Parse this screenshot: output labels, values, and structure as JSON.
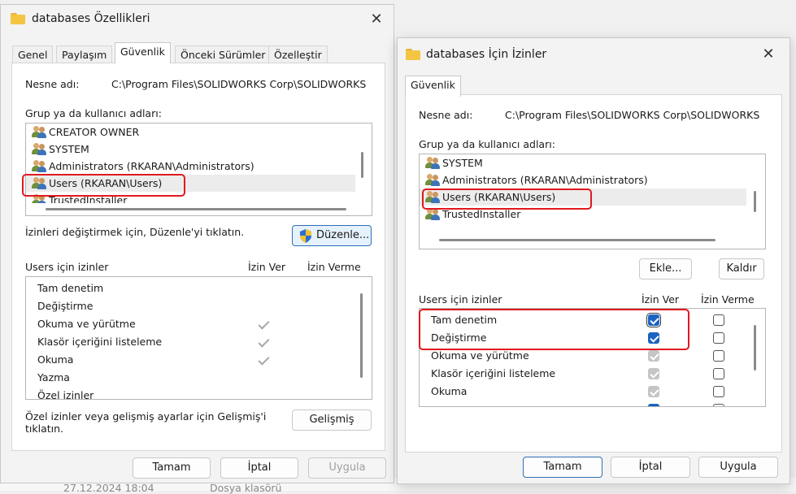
{
  "win1": {
    "title": "databases Özellikleri",
    "tabs": [
      "Genel",
      "Paylaşım",
      "Güvenlik",
      "Önceki Sürümler",
      "Özelleştir"
    ],
    "object_label": "Nesne adı:",
    "object_value": "C:\\Program Files\\SOLIDWORKS Corp\\SOLIDWORKS",
    "group_label": "Grup ya da kullanıcı adları:",
    "users": [
      "CREATOR OWNER",
      "SYSTEM",
      "Administrators (RKARAN\\Administrators)",
      "Users (RKARAN\\Users)",
      "TrustedInstaller"
    ],
    "edit_hint": "İzinleri değiştirmek için, Düzenle'yi tıklatın.",
    "edit_button": "Düzenle...",
    "perm_header": "Users için izinler",
    "allow_header": "İzin Ver",
    "deny_header": "İzin Verme",
    "permissions": [
      "Tam denetim",
      "Değiştirme",
      "Okuma ve yürütme",
      "Klasör içeriğini listeleme",
      "Okuma",
      "Yazma",
      "Özel izinler"
    ],
    "advanced_hint": "Özel izinler veya gelişmiş ayarlar için Gelişmiş'i tıklatın.",
    "advanced_button": "Gelişmiş",
    "ok": "Tamam",
    "cancel": "İptal",
    "apply": "Uygula"
  },
  "win2": {
    "title": "databases İçin İzinler",
    "tab": "Güvenlik",
    "object_label": "Nesne adı:",
    "object_value": "C:\\Program Files\\SOLIDWORKS Corp\\SOLIDWORKS",
    "group_label": "Grup ya da kullanıcı adları:",
    "users": [
      "SYSTEM",
      "Administrators (RKARAN\\Administrators)",
      "Users (RKARAN\\Users)",
      "TrustedInstaller"
    ],
    "add_button": "Ekle...",
    "remove_button": "Kaldır",
    "perm_header": "Users için izinler",
    "allow_header": "İzin Ver",
    "deny_header": "İzin Verme",
    "permissions": [
      "Tam denetim",
      "Değiştirme",
      "Okuma ve yürütme",
      "Klasör içeriğini listeleme",
      "Okuma"
    ],
    "ok": "Tamam",
    "cancel": "İptal",
    "apply": "Uygula"
  },
  "background": {
    "date": "27.12.2024 18:04",
    "type": "Dosya klasörü"
  }
}
